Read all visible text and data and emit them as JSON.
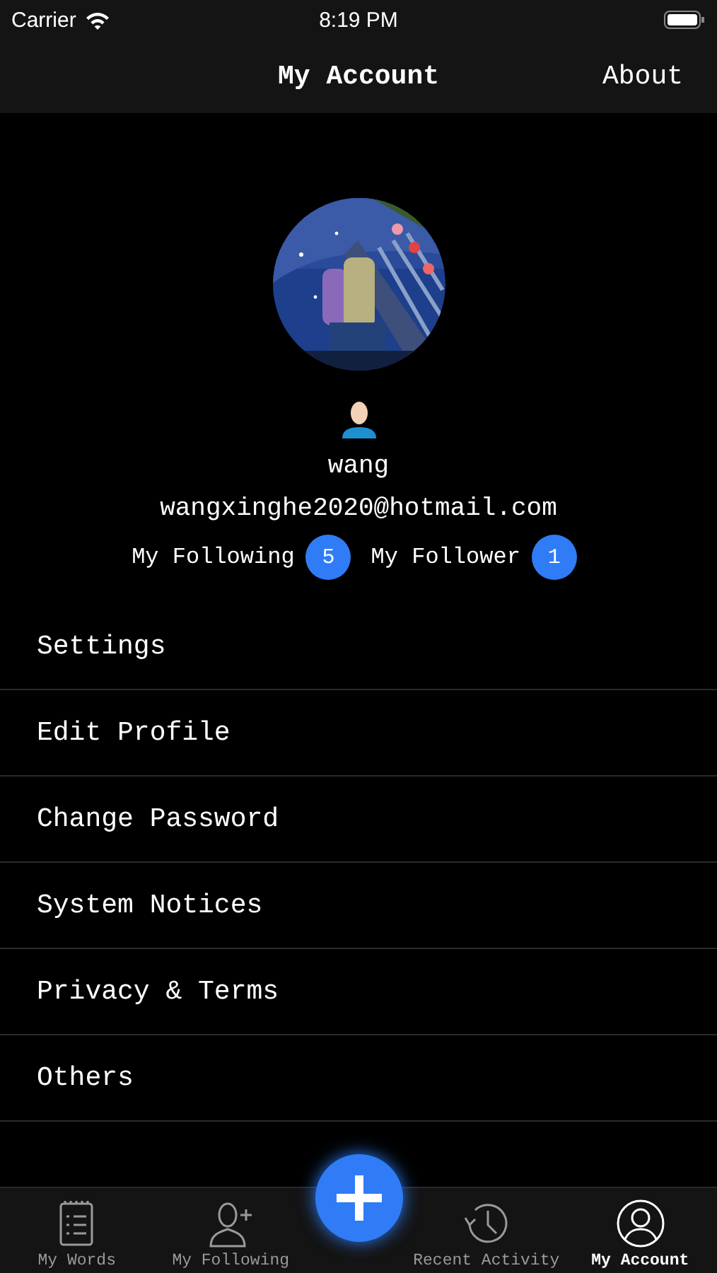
{
  "status_bar": {
    "carrier": "Carrier",
    "time": "8:19 PM"
  },
  "nav": {
    "title": "My Account",
    "action": "About"
  },
  "profile": {
    "name": "wang",
    "email": "wangxinghe2020@hotmail.com",
    "stats": [
      {
        "label": "My Following",
        "count": "5"
      },
      {
        "label": "My Follower",
        "count": "1"
      }
    ]
  },
  "menu": [
    "Settings",
    "Edit Profile",
    "Change Password",
    "System Notices",
    "Privacy & Terms",
    "Others"
  ],
  "tabs": [
    {
      "label": "My Words",
      "kind": "notes",
      "selected": false
    },
    {
      "label": "My Following",
      "kind": "adduser",
      "selected": false
    },
    {
      "label": "Recent Activity",
      "kind": "history",
      "selected": false
    },
    {
      "label": "My Account",
      "kind": "user",
      "selected": true
    }
  ]
}
